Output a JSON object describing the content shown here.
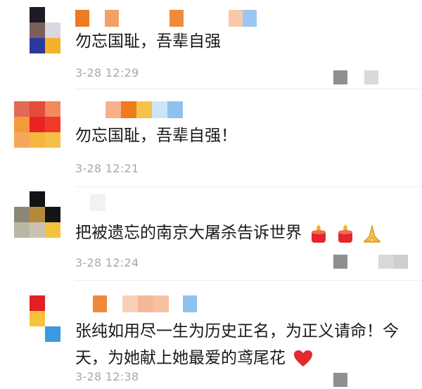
{
  "comments": [
    {
      "text": "勿忘国耻，吾辈自强",
      "time": "3-28 12:29"
    },
    {
      "text": "勿忘国耻，吾辈自强！",
      "time": "3-28 12:21"
    },
    {
      "text": "把被遗忘的南京大屠杀告诉世界",
      "emojis": [
        "candle-icon",
        "candle-icon",
        "pray-icon"
      ],
      "time": "3-28 12:24"
    },
    {
      "text": "张纯如用尽一生为历史正名，为正义请命！今天，为她献上她最爱的鸢尾花",
      "emojis": [
        "heart-icon"
      ],
      "time": "3-28 12:38"
    }
  ]
}
